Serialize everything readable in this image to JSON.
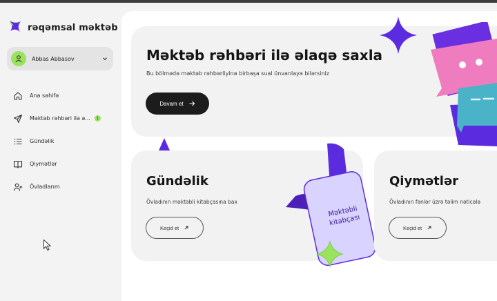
{
  "app": {
    "name": "rəqəmsal məktəb"
  },
  "user": {
    "name": "Abbas Abbasov"
  },
  "sidebar": {
    "items": [
      {
        "label": "Ana səhifə",
        "icon": "home-icon"
      },
      {
        "label": "Məktəb rəhbəri ilə ə...",
        "icon": "send-icon",
        "badge": "1"
      },
      {
        "label": "Gündəlik",
        "icon": "list-icon"
      },
      {
        "label": "Qiymətlər",
        "icon": "book-icon"
      },
      {
        "label": "Övladlarım",
        "icon": "user-plus-icon"
      }
    ]
  },
  "hero": {
    "title": "Məktəb rəhbəri ilə əlaqə saxla",
    "subtitle": "Bu bölmədə məktəb rəhbərliyinə birbaşa sual ünvanlaya bilərsiniz",
    "button": "Davam et"
  },
  "cards": [
    {
      "title": "Gündəlik",
      "subtitle": "Övladının məktəbli kitabçasına bax",
      "button": "Keçid et"
    },
    {
      "title": "Qiymətlər",
      "subtitle": "Övladının fənlər üzrə təlim nəticələ",
      "button": "Keçid et"
    }
  ],
  "illustration": {
    "text": "Məktəbli kitabçası"
  },
  "colors": {
    "accent_purple": "#5b2be0",
    "accent_green": "#9be25f",
    "pink": "#f07cc0",
    "teal": "#4ab3c8"
  }
}
